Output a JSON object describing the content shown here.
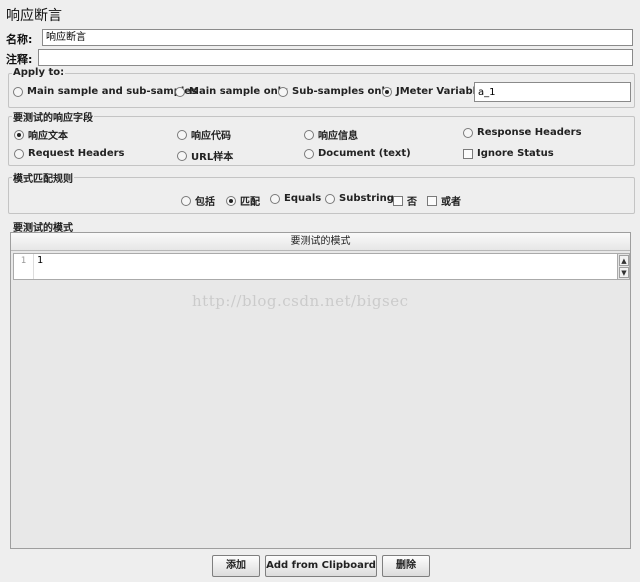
{
  "panel": {
    "title": "响应断言",
    "name_label": "名称:",
    "name_value": "响应断言",
    "comment_label": "注释:",
    "comment_value": ""
  },
  "apply_to": {
    "title": "Apply to:",
    "options": [
      "Main sample and sub-samples",
      "Main sample only",
      "Sub-samples only",
      "JMeter Variable"
    ],
    "selected": "JMeter Variable",
    "variable_value": "a_1"
  },
  "response_field": {
    "title": "要测试的响应字段",
    "options": [
      "响应文本",
      "响应代码",
      "响应信息",
      "Response Headers",
      "Request Headers",
      "URL样本",
      "Document (text)"
    ],
    "selected": "响应文本",
    "ignore_status_label": "Ignore Status",
    "ignore_status_checked": false
  },
  "pattern_rules": {
    "title": "模式匹配规则",
    "options": [
      "包括",
      "匹配",
      "Equals",
      "Substring"
    ],
    "selected": "匹配",
    "not_label": "否",
    "or_label": "或者"
  },
  "patterns": {
    "title": "要测试的模式",
    "column_header": "要测试的模式",
    "rows": [
      {
        "line": "1",
        "text": "1"
      }
    ]
  },
  "buttons": {
    "add": "添加",
    "add_clipboard": "Add from Clipboard",
    "delete": "删除"
  },
  "watermark": "http://blog.csdn.net/bigsec"
}
